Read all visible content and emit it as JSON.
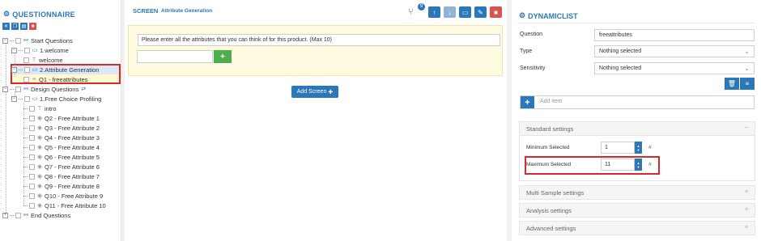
{
  "questionnaire": {
    "title": "QUESTIONNAIRE",
    "tree": [
      {
        "label": "Start Questions",
        "icon": "sitemap-icon"
      },
      {
        "label": "1.welcome",
        "icon": "monitor-icon"
      },
      {
        "label": "welcome",
        "icon": "text-icon"
      },
      {
        "label": "2.Attribute Generation",
        "icon": "monitor-icon"
      },
      {
        "label": "Q1 - freeattributes",
        "icon": "list-icon"
      },
      {
        "label": "Design Questions",
        "icon": "sitemap-icon"
      },
      {
        "label": "1.Free Choice Profiling",
        "icon": "monitor-icon"
      },
      {
        "label": "intro",
        "icon": "text-icon"
      },
      {
        "label": "Q2 - Free Attribute 1",
        "icon": "eye-icon"
      },
      {
        "label": "Q3 - Free Attribute 2",
        "icon": "eye-icon"
      },
      {
        "label": "Q4 - Free Attribute 3",
        "icon": "eye-icon"
      },
      {
        "label": "Q5 - Free Attribute 4",
        "icon": "eye-icon"
      },
      {
        "label": "Q6 - Free Attribute 5",
        "icon": "eye-icon"
      },
      {
        "label": "Q7 - Free Attribute 6",
        "icon": "eye-icon"
      },
      {
        "label": "Q8 - Free Attribute 7",
        "icon": "eye-icon"
      },
      {
        "label": "Q9 - Free Attribute 8",
        "icon": "eye-icon"
      },
      {
        "label": "Q10 - Free Attribute 9",
        "icon": "eye-icon"
      },
      {
        "label": "Q11 - Free Attribute 10",
        "icon": "eye-icon"
      },
      {
        "label": "End Questions",
        "icon": "sitemap-icon"
      }
    ]
  },
  "screen": {
    "label": "SCREEN",
    "name": "Attribute Generation",
    "badge_count": "9",
    "question_text": "Please enter all the attributes that you can think of for this product. (Max 10)",
    "add_screen_label": "Add Screen"
  },
  "dynamiclist": {
    "title": "DYNAMICLIST",
    "question_label": "Question",
    "question_value": "freeattributes",
    "type_label": "Type",
    "type_value": "Nothing selected",
    "sensitivity_label": "Sensitivity",
    "sensitivity_value": "Nothing selected",
    "add_item_placeholder": "Add item",
    "standard_settings": "Standard settings",
    "min_label": "Minimum Selected",
    "min_value": "1",
    "max_label": "Maximum Selected",
    "max_value": "11",
    "hash": "#",
    "multi_sample": "Multi Sample settings",
    "analysis": "Analysis settings",
    "advanced": "Advanced settings"
  },
  "colors": {
    "accent": "#2b77b8",
    "danger": "#d9534f",
    "success": "#4cae4c",
    "highlight_border": "#d62a2a"
  }
}
